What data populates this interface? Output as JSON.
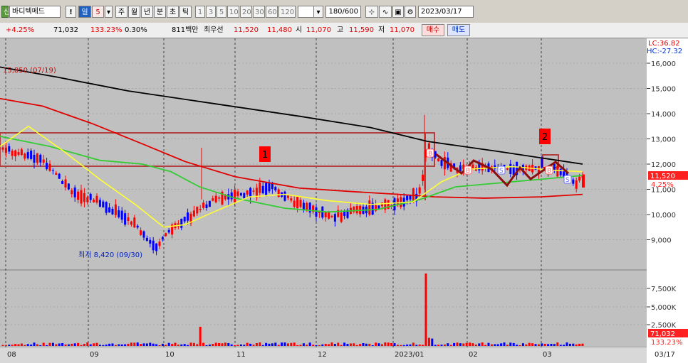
{
  "toolbar": {
    "stock_name": "바디텍메드",
    "period_buttons": [
      "일",
      "주",
      "월",
      "년",
      "분",
      "초",
      "틱"
    ],
    "period_count": "5",
    "minute_buttons": [
      "1",
      "3",
      "5",
      "10",
      "20",
      "30",
      "60",
      "120"
    ],
    "bar_count": "180/600",
    "date": "2023/03/17",
    "mark": "!"
  },
  "quote": {
    "change_pct": "+4.25%",
    "volume": "71,032",
    "volume_ratio": "133.23%",
    "turnover_ratio": "0.30%",
    "trade_value": "811백만",
    "best_ask_label": "최우선",
    "best_ask": "11,520",
    "best_bid": "11,480",
    "open_label": "시",
    "open": "11,070",
    "high_label": "고",
    "high": "11,590",
    "low_label": "저",
    "low": "11,070",
    "buy_label": "매수",
    "sell_label": "매도"
  },
  "chart_data": {
    "type": "candlestick",
    "price_axis": {
      "ticks": [
        "16,000",
        "15,000",
        "14,000",
        "13,000",
        "12,000",
        "11,000",
        "10,000",
        "9,000"
      ],
      "range": [
        8200,
        16900
      ]
    },
    "volume_axis": {
      "ticks": [
        "7,500K",
        "5,000K",
        "2,500K"
      ]
    },
    "x_ticks": [
      "08",
      "09",
      "10",
      "11",
      "12",
      "2023/01",
      "02",
      "03",
      "03/17"
    ],
    "lc_label": "LC:36.82",
    "hc_label": "HC:-27.32",
    "high_annotation": "15,850 (07/19)",
    "low_annotation": "최저 8,420 (09/30)",
    "current_price_tag": "11,520",
    "current_change_tag": "4.25%",
    "current_volume_tag": "71,032",
    "current_volume_ratio_tag": "133.23%",
    "box_labels": [
      "1",
      "2"
    ],
    "signal_labels": [
      "B",
      "S"
    ],
    "colors": {
      "up": "#ff0000",
      "down": "#0000ff",
      "ma_long": "#000000",
      "ma_mid": "#e00000",
      "ma_short": "#ffff33",
      "ma_green": "#33cc33",
      "box": "#b04040"
    }
  }
}
